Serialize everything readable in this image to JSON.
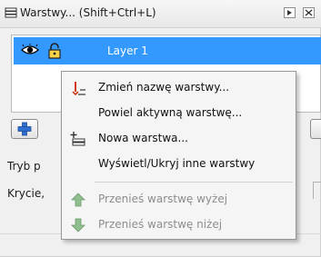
{
  "window": {
    "title": "Warstwy... (Shift+Ctrl+L)",
    "icons": [
      "layers-icon",
      "menu-icon",
      "close-icon"
    ]
  },
  "layers": [
    {
      "name": "Layer 1",
      "visible": true,
      "locked": true,
      "selected": true
    }
  ],
  "colors": {
    "selection": "#3399ff",
    "arrow_disabled": "#8fbf8f"
  },
  "controls": {
    "blend_label_visible": "Tryb p",
    "opacity_label_visible": "Krycie,"
  },
  "context_menu": {
    "items": [
      {
        "label": "Zmień nazwę warstwy...",
        "icon": "rename-icon",
        "enabled": true
      },
      {
        "label": "Powiel aktywną warstwę...",
        "icon": "",
        "enabled": true
      },
      {
        "label": "Nowa warstwa...",
        "icon": "new-layer-icon",
        "enabled": true
      },
      {
        "label": "Wyświetl/Ukryj inne warstwy",
        "icon": "",
        "enabled": true
      },
      {
        "label": "Przenieś warstwę wyżej",
        "icon": "arrow-up-icon",
        "enabled": false
      },
      {
        "label": "Przenieś warstwę niżej",
        "icon": "arrow-down-icon",
        "enabled": false
      }
    ]
  }
}
